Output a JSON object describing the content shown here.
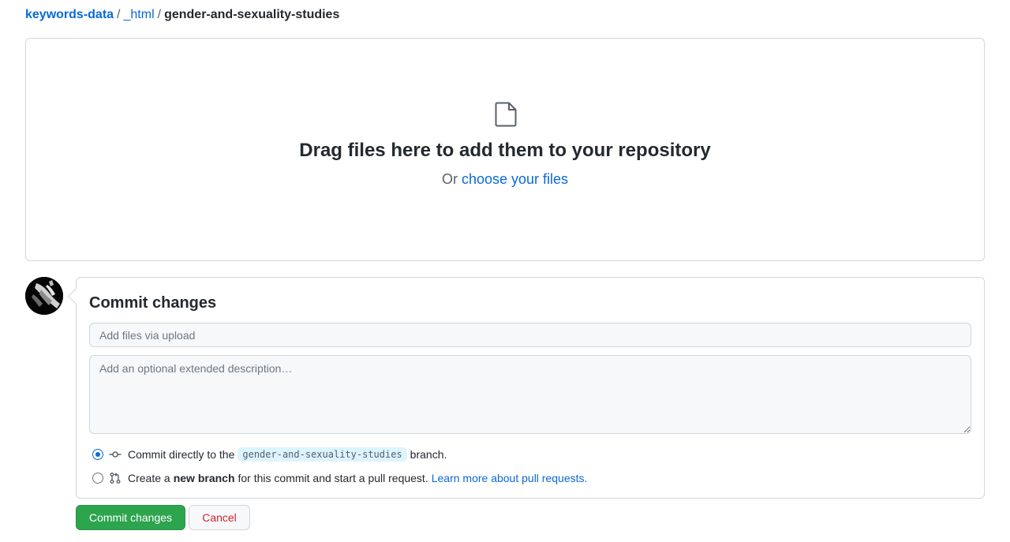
{
  "breadcrumb": {
    "repo": "keywords-data",
    "sep1": "/",
    "folder": "_html",
    "sep2": "/",
    "current": "gender-and-sexuality-studies"
  },
  "dropzone": {
    "icon": "file-icon",
    "title": "Drag files here to add them to your repository",
    "or_text": "Or",
    "choose_link": "choose your files"
  },
  "commit": {
    "heading": "Commit changes",
    "summary_placeholder": "Add files via upload",
    "summary_value": "",
    "description_placeholder": "Add an optional extended description…",
    "description_value": "",
    "option_direct": {
      "icon": "git-commit-icon",
      "prefix": "Commit directly to the",
      "branch": "gender-and-sexuality-studies",
      "suffix": "branch.",
      "checked": true
    },
    "option_new_branch": {
      "icon": "git-pull-request-icon",
      "prefix": "Create a",
      "bold": "new branch",
      "middle": "for this commit and start a pull request.",
      "link": "Learn more about pull requests.",
      "checked": false
    }
  },
  "buttons": {
    "commit_label": "Commit changes",
    "cancel_label": "Cancel"
  },
  "colors": {
    "link": "#0969da",
    "primary": "#2da44e",
    "danger": "#cf222e",
    "border": "#d0d7de"
  }
}
